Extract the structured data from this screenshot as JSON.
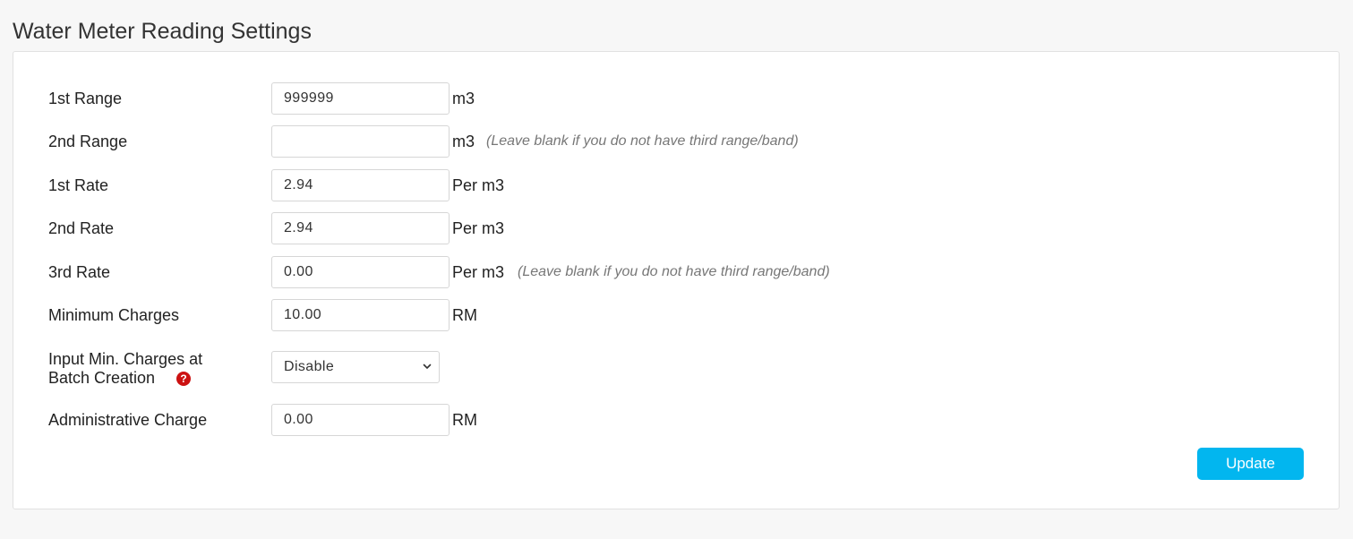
{
  "page": {
    "title": "Water Meter Reading Settings"
  },
  "form": {
    "range1": {
      "label": "1st Range",
      "value": "999999",
      "unit": "m3"
    },
    "range2": {
      "label": "2nd Range",
      "value": "",
      "unit": "m3",
      "hint": "(Leave blank if you do not have third range/band)"
    },
    "rate1": {
      "label": "1st Rate",
      "value": "2.94",
      "unit": "Per m3"
    },
    "rate2": {
      "label": "2nd Rate",
      "value": "2.94",
      "unit": "Per m3"
    },
    "rate3": {
      "label": "3rd Rate",
      "value": "0.00",
      "unit": "Per m3",
      "hint": "(Leave blank if you do not have third range/band)"
    },
    "min_charges": {
      "label": "Minimum Charges",
      "value": "10.00",
      "unit": "RM"
    },
    "input_min_charges": {
      "label_line1": "Input Min. Charges at",
      "label_line2": "Batch Creation",
      "selected": "Disable",
      "help_icon": "question-circle-icon",
      "help_color": "#cc1111"
    },
    "admin_charge": {
      "label": "Administrative Charge",
      "value": "0.00",
      "unit": "RM"
    }
  },
  "actions": {
    "update_label": "Update",
    "update_color": "#02b6ef"
  }
}
